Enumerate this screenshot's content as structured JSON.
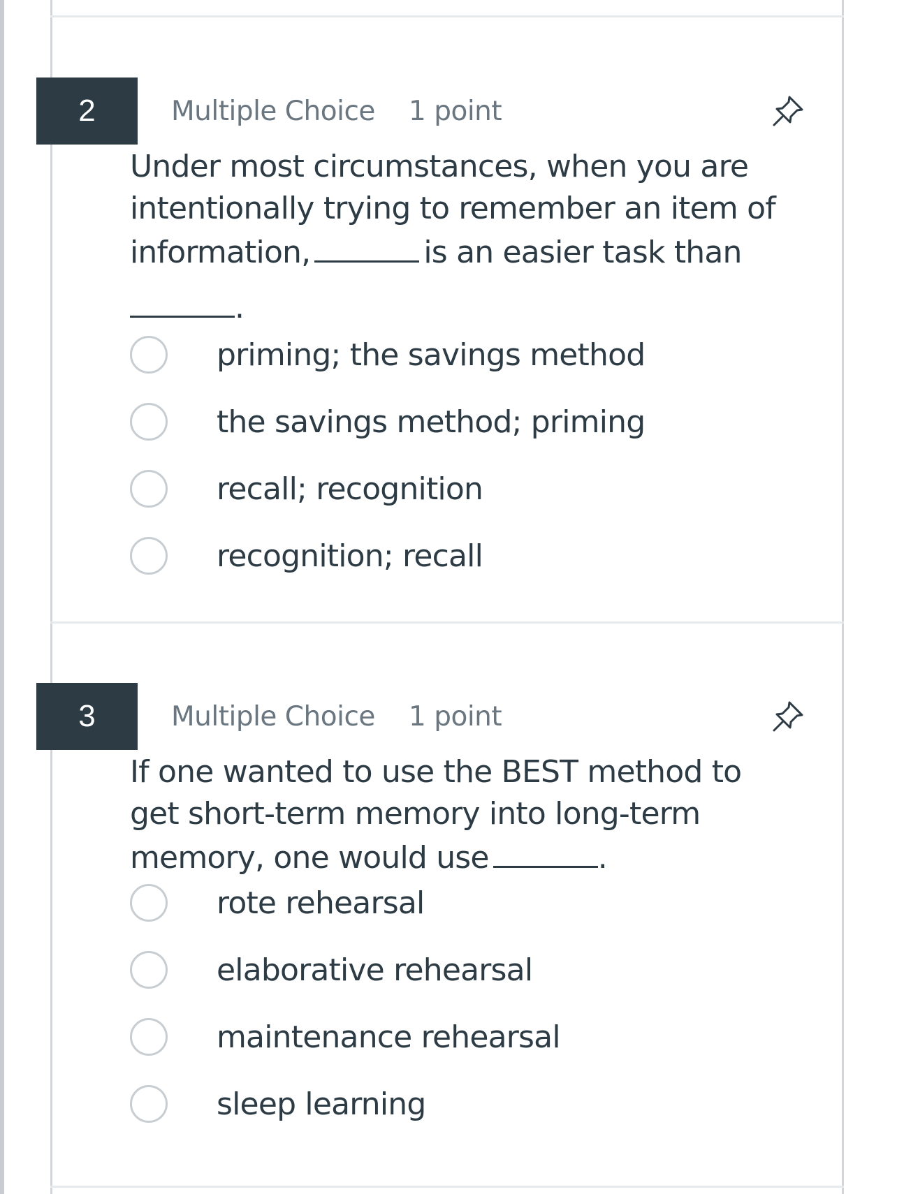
{
  "questions": [
    {
      "number": "2",
      "type": "Multiple Choice",
      "points": "1 point",
      "text_parts": [
        "Under most circumstances, when you are intentionally trying to remember an item of information,",
        "is an easier task than",
        "."
      ],
      "options": [
        "priming; the savings method",
        "the savings method; priming",
        "recall; recognition",
        "recognition; recall"
      ],
      "pin_icon": "pin-icon"
    },
    {
      "number": "3",
      "type": "Multiple Choice",
      "points": "1 point",
      "text_parts": [
        "If one wanted to use the BEST method to get short-term memory into long-term memory, one would use",
        "."
      ],
      "options": [
        "rote rehearsal",
        "elaborative rehearsal",
        "maintenance rehearsal",
        "sleep learning"
      ],
      "pin_icon": "pin-icon"
    }
  ],
  "colors": {
    "number_badge_bg": "#2d3b45",
    "text": "#2d3b45",
    "meta_text": "#6b7780",
    "radio_border": "#c7cdd1",
    "panel_border": "#d2d6da"
  }
}
